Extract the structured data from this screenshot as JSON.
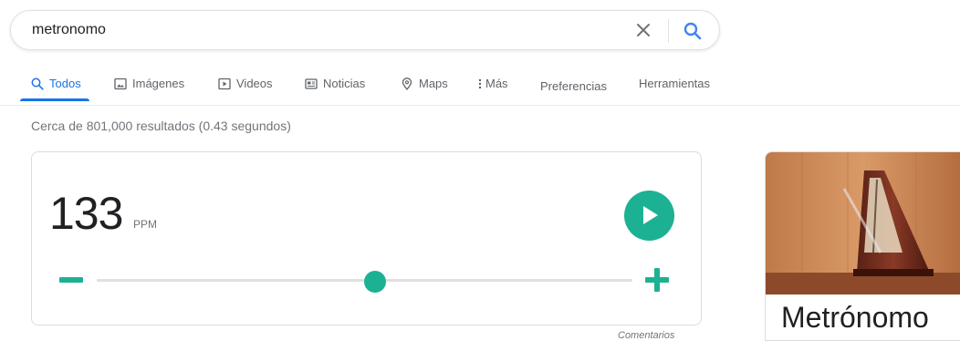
{
  "search": {
    "query": "metronomo"
  },
  "tabs": [
    {
      "label": "Todos",
      "icon": "search-icon",
      "active": true
    },
    {
      "label": "Imágenes",
      "icon": "image-icon"
    },
    {
      "label": "Videos",
      "icon": "video-icon"
    },
    {
      "label": "Noticias",
      "icon": "news-icon"
    },
    {
      "label": "Maps",
      "icon": "map-pin-icon"
    },
    {
      "label": "Más",
      "icon": "more-vert-icon"
    },
    {
      "label": "Preferencias"
    },
    {
      "label": "Herramientas"
    }
  ],
  "result_stats": "Cerca de 801,000 resultados (0.43 segundos)",
  "metronome": {
    "bpm": "133",
    "unit": "PPM",
    "slider_fraction": 0.52,
    "accent_color": "#1db193"
  },
  "feedback_label": "Comentarios",
  "knowledge_panel": {
    "title": "Metrónomo"
  },
  "colors": {
    "link_blue": "#1a73e8",
    "text_gray": "#70757a"
  }
}
